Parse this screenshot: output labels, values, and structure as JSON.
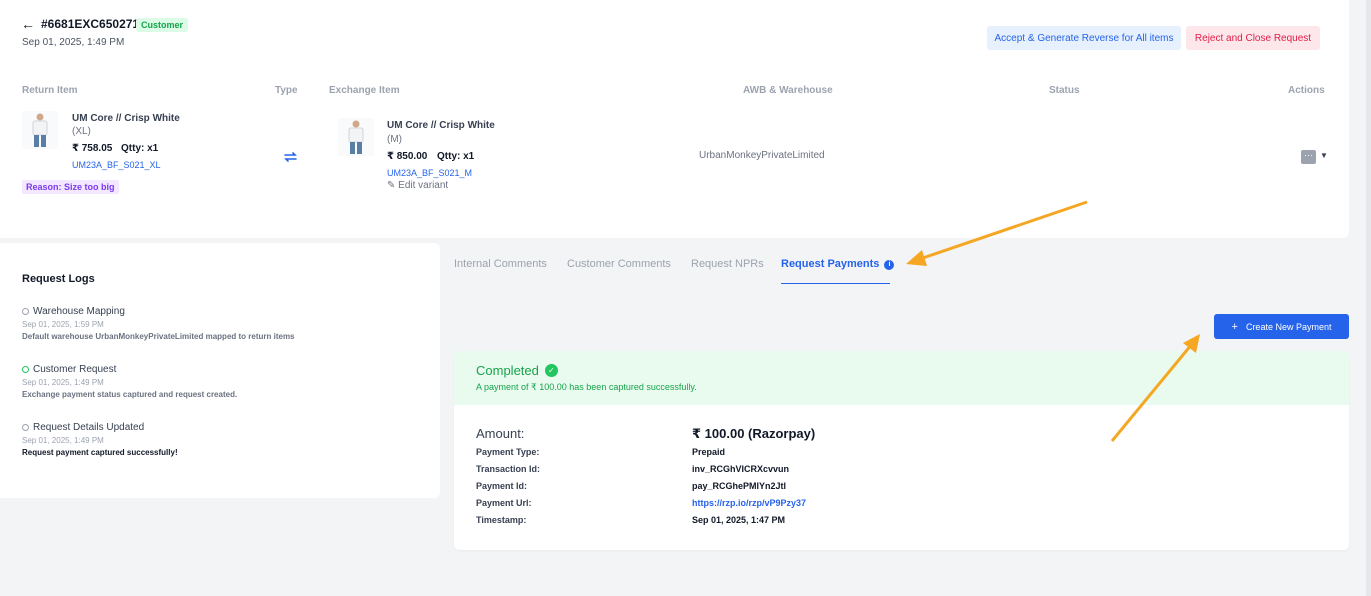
{
  "header": {
    "back_symbol": "←",
    "request_id": "#6681EXC650271",
    "badge": "Customer",
    "date": "Sep 01, 2025, 1:49 PM",
    "accept_label": "Accept & Generate Reverse for All items",
    "reject_label": "Reject and Close Request"
  },
  "table": {
    "headers": [
      "Return Item",
      "Type",
      "Exchange Item",
      "AWB & Warehouse",
      "Status",
      "Actions"
    ],
    "return_item": {
      "name": "UM Core // Crisp White",
      "size": "(XL)",
      "price": "₹ 758.05",
      "qty": "Qtty: x1",
      "sku": "UM23A_BF_S021_XL",
      "reason": "Reason: Size too big"
    },
    "exchange_item": {
      "name": "UM Core // Crisp White",
      "size": "(M)",
      "price": "₹ 850.00",
      "qty": "Qtty: x1",
      "sku": "UM23A_BF_S021_M",
      "edit_label": "Edit variant"
    },
    "awb": "UrbanMonkeyPrivateLimited",
    "actions_icon": "···"
  },
  "logs": {
    "title": "Request Logs",
    "entries": [
      {
        "title": "Warehouse Mapping",
        "time": "Sep 01, 2025, 1:59 PM",
        "desc": "Default warehouse UrbanMonkeyPrivateLimited mapped to return items"
      },
      {
        "title": "Customer Request",
        "time": "Sep 01, 2025, 1:49 PM",
        "desc": "Exchange payment status captured and request created."
      },
      {
        "title": "Request Details Updated",
        "time": "Sep 01, 2025, 1:49 PM",
        "desc": "Request payment captured successfully!"
      }
    ]
  },
  "tabs": [
    {
      "label": "Internal Comments"
    },
    {
      "label": "Customer Comments"
    },
    {
      "label": "Request NPRs"
    },
    {
      "label": "Request Payments"
    }
  ],
  "create_payment_label": "Create New Payment",
  "payment": {
    "status": "Completed",
    "message": "A payment of ₹ 100.00 has been captured successfully.",
    "amount_label": "Amount:",
    "amount_value": "₹ 100.00 (Razorpay)",
    "rows": [
      {
        "label": "Payment Type:",
        "value": "Prepaid"
      },
      {
        "label": "Transaction Id:",
        "value": "inv_RCGhVICRXcvvun"
      },
      {
        "label": "Payment Id:",
        "value": "pay_RCGhePMIYn2Jtl"
      },
      {
        "label": "Payment Url:",
        "value": "https://rzp.io/rzp/vP9Pzy37"
      },
      {
        "label": "Timestamp:",
        "value": "Sep 01, 2025, 1:47 PM"
      }
    ]
  },
  "colors": {
    "accent": "#2563eb",
    "success": "#16a34a",
    "annotation_arrow": "#f5a623"
  }
}
